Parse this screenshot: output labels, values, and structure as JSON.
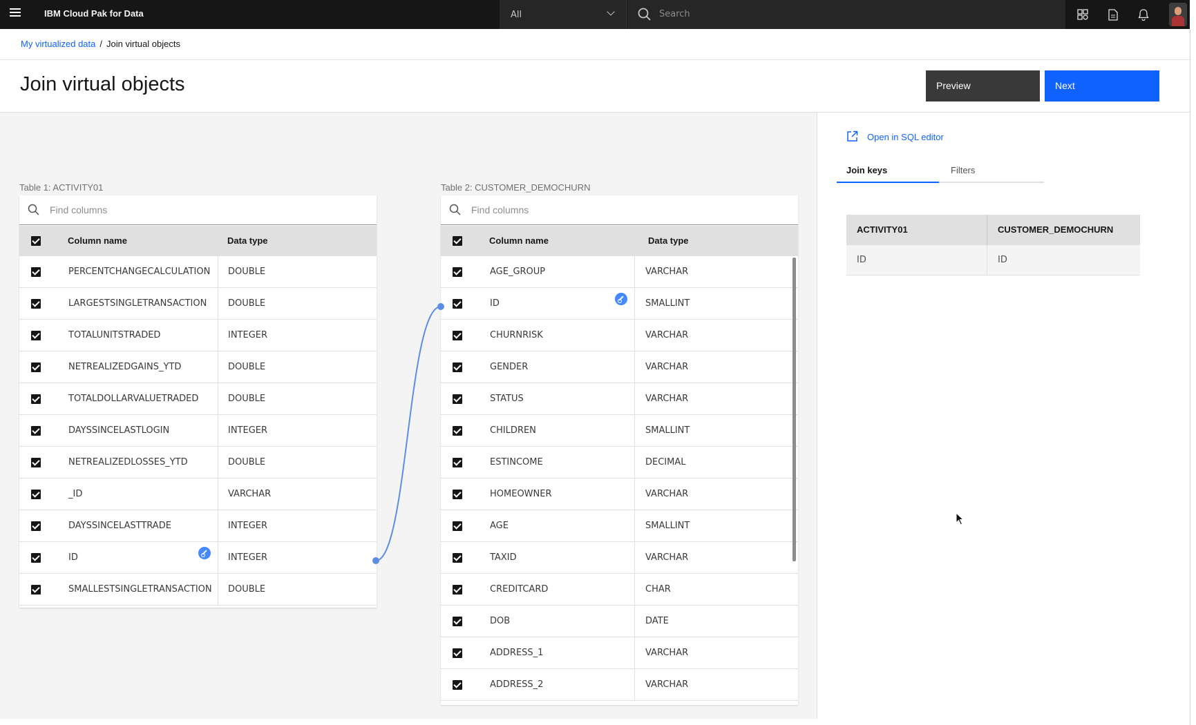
{
  "topbar": {
    "app_title": "IBM Cloud Pak for Data",
    "scope_value": "All",
    "search_placeholder": "Search"
  },
  "breadcrumb": {
    "parent": "My virtualized data",
    "separator": "/",
    "current": "Join virtual objects"
  },
  "page": {
    "title": "Join virtual objects",
    "preview_label": "Preview",
    "next_label": "Next"
  },
  "table1": {
    "label": "Table 1: ACTIVITY01",
    "search_placeholder": "Find columns",
    "col_name_header": "Column name",
    "col_type_header": "Data type",
    "rows": [
      {
        "name": "PERCENTCHANGECALCULATION",
        "type": "DOUBLE"
      },
      {
        "name": "LARGESTSINGLETRANSACTION",
        "type": "DOUBLE"
      },
      {
        "name": "TOTALUNITSTRADED",
        "type": "INTEGER"
      },
      {
        "name": "NETREALIZEDGAINS_YTD",
        "type": "DOUBLE"
      },
      {
        "name": "TOTALDOLLARVALUETRADED",
        "type": "DOUBLE"
      },
      {
        "name": "DAYSSINCELASTLOGIN",
        "type": "INTEGER"
      },
      {
        "name": "NETREALIZEDLOSSES_YTD",
        "type": "DOUBLE"
      },
      {
        "name": "_ID",
        "type": "VARCHAR"
      },
      {
        "name": "DAYSSINCELASTTRADE",
        "type": "INTEGER"
      },
      {
        "name": "ID",
        "type": "INTEGER"
      },
      {
        "name": "SMALLESTSINGLETRANSACTION",
        "type": "DOUBLE"
      }
    ]
  },
  "table2": {
    "label": "Table 2: CUSTOMER_DEMOCHURN",
    "search_placeholder": "Find columns",
    "col_name_header": "Column name",
    "col_type_header": "Data type",
    "rows": [
      {
        "name": "AGE_GROUP",
        "type": "VARCHAR"
      },
      {
        "name": "ID",
        "type": "SMALLINT"
      },
      {
        "name": "CHURNRISK",
        "type": "VARCHAR"
      },
      {
        "name": "GENDER",
        "type": "VARCHAR"
      },
      {
        "name": "STATUS",
        "type": "VARCHAR"
      },
      {
        "name": "CHILDREN",
        "type": "SMALLINT"
      },
      {
        "name": "ESTINCOME",
        "type": "DECIMAL"
      },
      {
        "name": "HOMEOWNER",
        "type": "VARCHAR"
      },
      {
        "name": "AGE",
        "type": "SMALLINT"
      },
      {
        "name": "TAXID",
        "type": "VARCHAR"
      },
      {
        "name": "CREDITCARD",
        "type": "CHAR"
      },
      {
        "name": "DOB",
        "type": "DATE"
      },
      {
        "name": "ADDRESS_1",
        "type": "VARCHAR"
      },
      {
        "name": "ADDRESS_2",
        "type": "VARCHAR"
      }
    ]
  },
  "side_panel": {
    "sql_link": "Open in SQL editor",
    "tab_join_keys": "Join keys",
    "tab_filters": "Filters",
    "keys_header_left": "ACTIVITY01",
    "keys_header_right": "CUSTOMER_DEMOCHURN",
    "keys_row_left": "ID",
    "keys_row_right": "ID"
  },
  "colors": {
    "accent": "#0f62fe",
    "topbar_bg": "#161616",
    "connector": "#5b8de6",
    "key_icon": "#4589ff"
  },
  "icons": [
    "menu-icon",
    "chevron-down-icon",
    "search-icon",
    "catalog-icon",
    "document-icon",
    "notification-icon",
    "launch-icon",
    "key-icon",
    "mouse-cursor-icon"
  ]
}
